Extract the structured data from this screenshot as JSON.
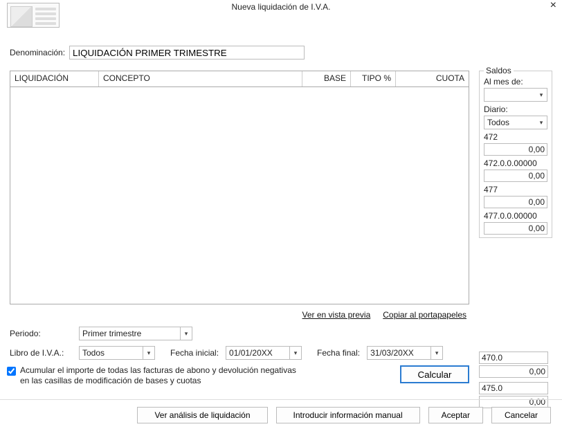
{
  "window": {
    "title": "Nueva liquidación de I.V.A."
  },
  "denom": {
    "label": "Denominación:",
    "value": "LIQUIDACIÓN PRIMER TRIMESTRE"
  },
  "table": {
    "headers": {
      "liq": "LIQUIDACIÓN",
      "con": "CONCEPTO",
      "base": "BASE",
      "tipo": "TIPO %",
      "cuota": "CUOTA"
    }
  },
  "links": {
    "preview": "Ver en vista previa",
    "clipboard": "Copiar al portapapeles"
  },
  "form": {
    "periodo": {
      "label": "Periodo:",
      "value": "Primer trimestre"
    },
    "libro": {
      "label": "Libro de I.V.A.:",
      "value": "Todos"
    },
    "fini": {
      "label": "Fecha inicial:",
      "value": "01/01/20XX"
    },
    "ffin": {
      "label": "Fecha final:",
      "value": "31/03/20XX"
    },
    "checkbox": {
      "text": "Acumular el importe de todas las facturas de abono y devolución negativas en las casillas de modificación de bases y cuotas",
      "checked": true
    },
    "calcular": "Calcular"
  },
  "saldos": {
    "legend": "Saldos",
    "almes": {
      "label": "Al mes de:",
      "value": ""
    },
    "diario": {
      "label": "Diario:",
      "value": "Todos"
    },
    "accounts": [
      {
        "label": "472",
        "value": "0,00"
      },
      {
        "label": "472.0.0.00000",
        "value": "0,00"
      },
      {
        "label": "477",
        "value": "0,00"
      },
      {
        "label": "477.0.0.00000",
        "value": "0,00"
      }
    ],
    "lower": [
      {
        "code": "470.0",
        "value": "0,00"
      },
      {
        "code": "475.0",
        "value": "0,00"
      }
    ]
  },
  "buttons": {
    "analisis": "Ver análisis de liquidación",
    "manual": "Introducir información manual",
    "aceptar": "Aceptar",
    "cancelar": "Cancelar"
  }
}
